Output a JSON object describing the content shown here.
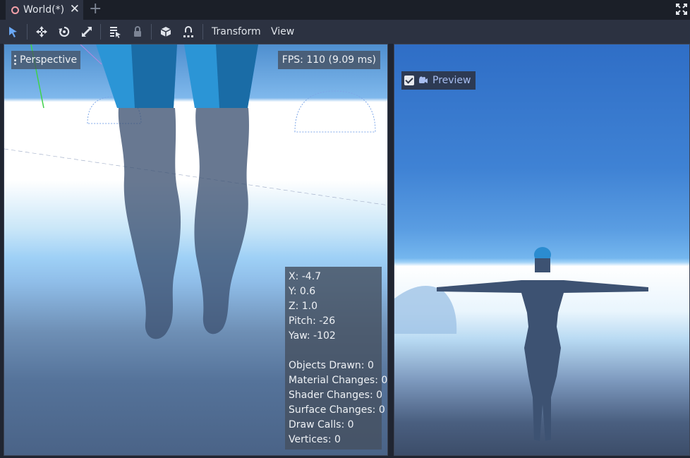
{
  "tabs": [
    {
      "title": "World(*)",
      "icon": "node-icon",
      "close": "✕"
    }
  ],
  "tab_add": "+",
  "toolbar": {
    "tools": [
      "select-icon",
      "move-icon",
      "rotate-icon",
      "scale-icon",
      "list-select-icon",
      "lock-icon",
      "group-icon",
      "snap-icon"
    ],
    "menus": {
      "transform": "Transform",
      "view": "View"
    }
  },
  "viewport": {
    "perspective_label": "Perspective",
    "fps": "FPS: 110 (9.09 ms)",
    "stats": {
      "x": "X: -4.7",
      "y": "Y: 0.6",
      "z": "Z: 1.0",
      "pitch": "Pitch: -26",
      "yaw": "Yaw: -102",
      "objects_drawn": "Objects Drawn: 0",
      "material_changes": "Material Changes: 0",
      "shader_changes": "Shader Changes: 0",
      "surface_changes": "Surface Changes: 0",
      "draw_calls": "Draw Calls: 0",
      "vertices": "Vertices: 0"
    }
  },
  "preview": {
    "label": "Preview",
    "checked": true
  },
  "colors": {
    "editor_bg": "#202531",
    "panel_bg": "#2c3241",
    "accent_blue": "#4d9bf0",
    "tab_dot": "#f2a0a8",
    "preview_text": "#a7bdf0",
    "character": "#3d5272"
  }
}
